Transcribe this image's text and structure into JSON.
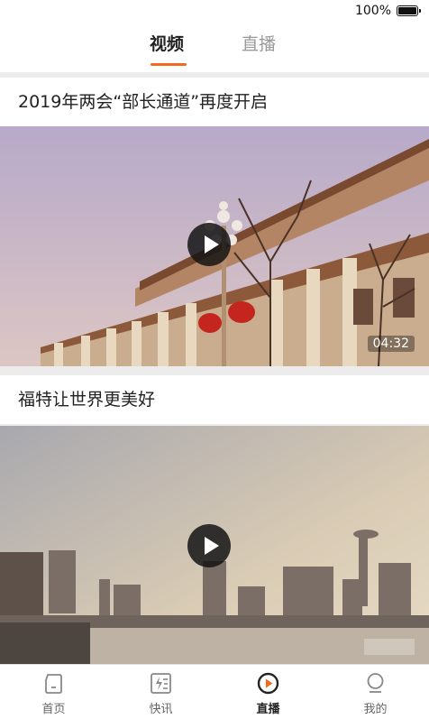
{
  "status_bar": {
    "battery_percent": "100%"
  },
  "top_tabs": [
    {
      "label": "视频",
      "active": true
    },
    {
      "label": "直播",
      "active": false
    }
  ],
  "accent_color": "#f26a1b",
  "feed": [
    {
      "title": "2019年两会“部长通道”再度开启",
      "duration": "04:32",
      "icon": "play-icon"
    },
    {
      "title": "福特让世界更美好",
      "icon": "play-icon"
    }
  ],
  "bottom_nav": [
    {
      "label": "首页",
      "icon": "home-icon",
      "active": false
    },
    {
      "label": "快讯",
      "icon": "flash-news-icon",
      "active": false
    },
    {
      "label": "直播",
      "icon": "live-play-icon",
      "active": true
    },
    {
      "label": "我的",
      "icon": "profile-icon",
      "active": false
    }
  ]
}
